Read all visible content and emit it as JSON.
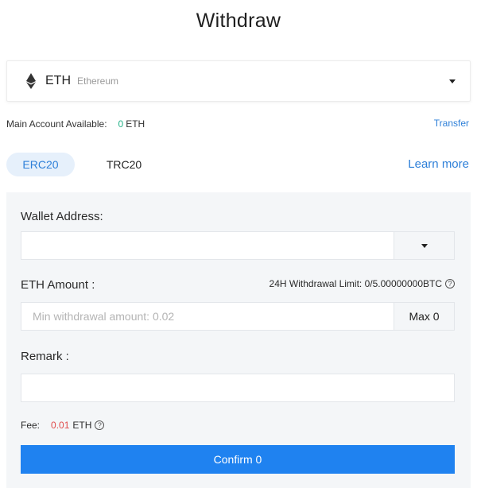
{
  "page": {
    "title": "Withdraw"
  },
  "coin": {
    "symbol": "ETH",
    "name": "Ethereum",
    "icon": "ethereum-icon"
  },
  "account": {
    "label": "Main Account Available:",
    "available": "0",
    "unit": "ETH",
    "transfer_label": "Transfer"
  },
  "network": {
    "tabs": [
      {
        "label": "ERC20",
        "active": true
      },
      {
        "label": "TRC20",
        "active": false
      }
    ],
    "learn_more": "Learn more"
  },
  "form": {
    "wallet_label": "Wallet Address:",
    "wallet_value": "",
    "amount_label": "ETH Amount :",
    "limit_text": "24H Withdrawal Limit: 0/5.00000000BTC",
    "amount_placeholder": "Min withdrawal amount: 0.02",
    "max_label": "Max 0",
    "remark_label": "Remark :",
    "remark_value": "",
    "fee_label": "Fee:",
    "fee_value": "0.01",
    "fee_unit": "ETH",
    "confirm_label": "Confirm 0"
  },
  "colors": {
    "accent": "#1f82f0",
    "link": "#2d7fd8",
    "available": "#27b38a",
    "fee": "#e04b4b",
    "panel_bg": "#f4f6f8"
  }
}
